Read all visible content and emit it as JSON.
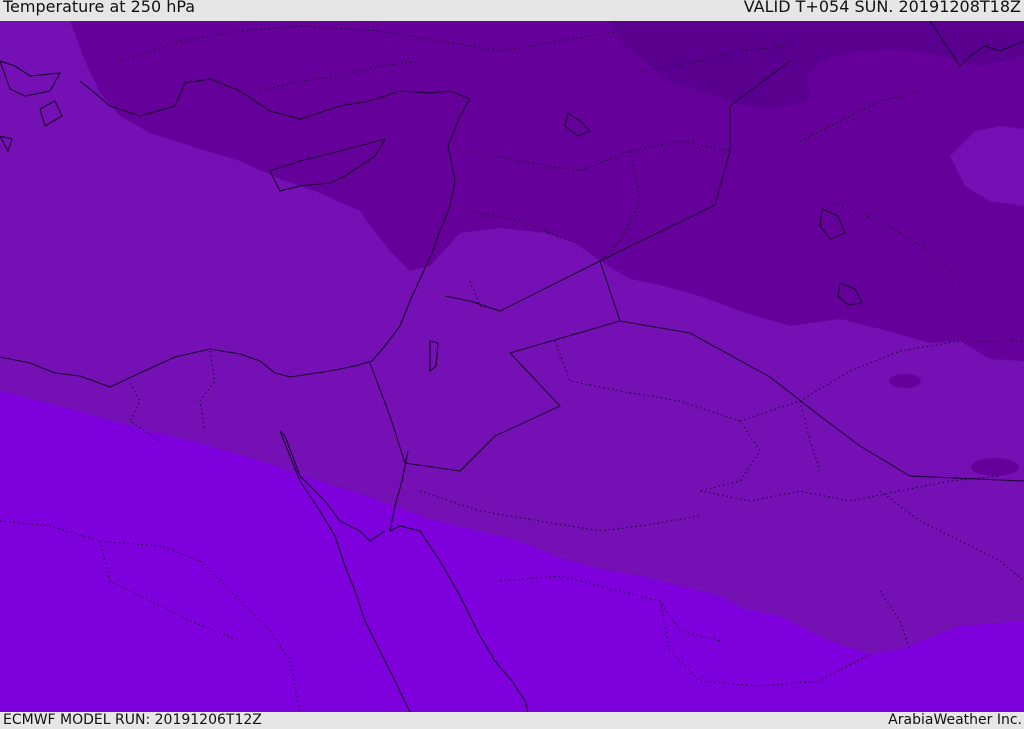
{
  "header": {
    "title": "Temperature at 250 hPa",
    "valid_time": "VALID T+054 SUN. 20191208T18Z"
  },
  "footer": {
    "model_run": "ECMWF MODEL RUN: 20191206T12Z",
    "credit": "ArabiaWeather Inc."
  },
  "colors": {
    "band_darkest": "#5a0090",
    "band_dark": "#66009a",
    "band_mid": "#7410b4",
    "band_bright": "#7e00dc",
    "coastline": "#1a0030",
    "border_line": "#1a0030"
  }
}
